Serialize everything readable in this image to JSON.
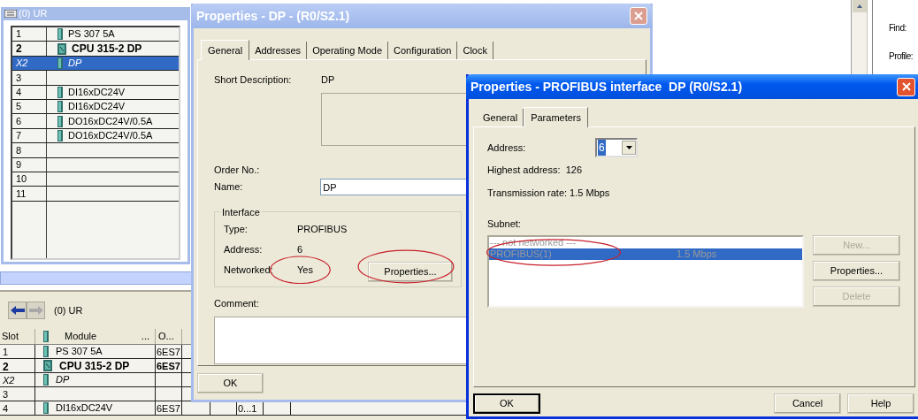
{
  "side_window": {
    "labels": [
      "Find:",
      "Profile:"
    ]
  },
  "rack_window": {
    "title": "(0) UR",
    "rows": [
      {
        "slot": "1",
        "module": "PS 307 5A",
        "kind": "module",
        "selected": false
      },
      {
        "slot": "2",
        "module": "CPU 315-2 DP",
        "kind": "cpu",
        "selected": false
      },
      {
        "slot": "X2",
        "module": "DP",
        "kind": "interface",
        "selected": true
      },
      {
        "slot": "3",
        "selected": false
      },
      {
        "slot": "4",
        "module": "DI16xDC24V",
        "kind": "module",
        "selected": false
      },
      {
        "slot": "5",
        "module": "DI16xDC24V",
        "kind": "module",
        "selected": false
      },
      {
        "slot": "6",
        "module": "DO16xDC24V/0.5A",
        "kind": "module",
        "selected": false
      },
      {
        "slot": "7",
        "module": "DO16xDC24V/0.5A",
        "kind": "module",
        "selected": false
      },
      {
        "slot": "8",
        "selected": false
      },
      {
        "slot": "9",
        "selected": false
      },
      {
        "slot": "10",
        "selected": false
      },
      {
        "slot": "11",
        "selected": false
      }
    ]
  },
  "module_table": {
    "title": "(0) UR",
    "columns": [
      "Slot",
      "Module",
      "O..."
    ],
    "module_more": "...",
    "rows": [
      {
        "slot": "1",
        "module": "PS 307 5A",
        "kind": "module",
        "order": "6ES7"
      },
      {
        "slot": "2",
        "module": "CPU 315-2 DP",
        "kind": "cpu",
        "order": "6ES7"
      },
      {
        "slot": "X2",
        "module": "DP",
        "kind": "interface"
      },
      {
        "slot": "3"
      },
      {
        "slot": "4",
        "module": "DI16xDC24V",
        "kind": "module",
        "order": "6ES7",
        "column_6": "0...1"
      }
    ]
  },
  "dp_dialog": {
    "title": "Properties - DP - (R0/S2.1)",
    "tabs": [
      {
        "label": "General",
        "selected": true
      },
      {
        "label": "Addresses",
        "selected": false
      },
      {
        "label": "Operating Mode",
        "selected": false
      },
      {
        "label": "Configuration",
        "selected": false
      },
      {
        "label": "Clock",
        "selected": false
      }
    ],
    "short_description": {
      "label": "Short Description:",
      "value": "DP"
    },
    "order_no": {
      "label": "Order No.:"
    },
    "name": {
      "label": "Name:",
      "value": "DP"
    },
    "interface": {
      "title": "Interface",
      "fields": [
        {
          "label": "Type:",
          "value": "PROFIBUS",
          "circled": false
        },
        {
          "label": "Address:",
          "value": "6",
          "circled": false
        },
        {
          "label": "Networked:",
          "value": "Yes",
          "circled": true
        }
      ],
      "properties_button": {
        "label": "Properties...",
        "circled": true
      }
    },
    "comment": {
      "label": "Comment:"
    },
    "buttons": [
      {
        "label": "OK",
        "default": false
      }
    ]
  },
  "profibus_dialog": {
    "title": "Properties - PROFIBUS interface  DP (R0/S2.1)",
    "tabs": [
      {
        "label": "General",
        "selected": false
      },
      {
        "label": "Parameters",
        "selected": true
      }
    ],
    "address": {
      "label": "Address:",
      "value": "6"
    },
    "highest_address": "Highest address:  126",
    "transmission_rate": "Transmission rate: 1.5 Mbps",
    "subnet": {
      "label": "Subnet:",
      "items": [
        {
          "name": "--- not networked ---",
          "selected": false,
          "circled": false
        },
        {
          "name": "PROFIBUS(1)",
          "rate": "1.5 Mbps",
          "selected": true,
          "circled": true
        }
      ]
    },
    "side_buttons": [
      {
        "label": "New...",
        "disabled": true
      },
      {
        "label": "Properties...",
        "disabled": false
      },
      {
        "label": "Delete",
        "disabled": true
      }
    ],
    "footer_buttons": [
      {
        "label": "OK",
        "default": true
      },
      {
        "label": "Cancel",
        "default": false
      },
      {
        "label": "Help",
        "default": false
      }
    ]
  }
}
